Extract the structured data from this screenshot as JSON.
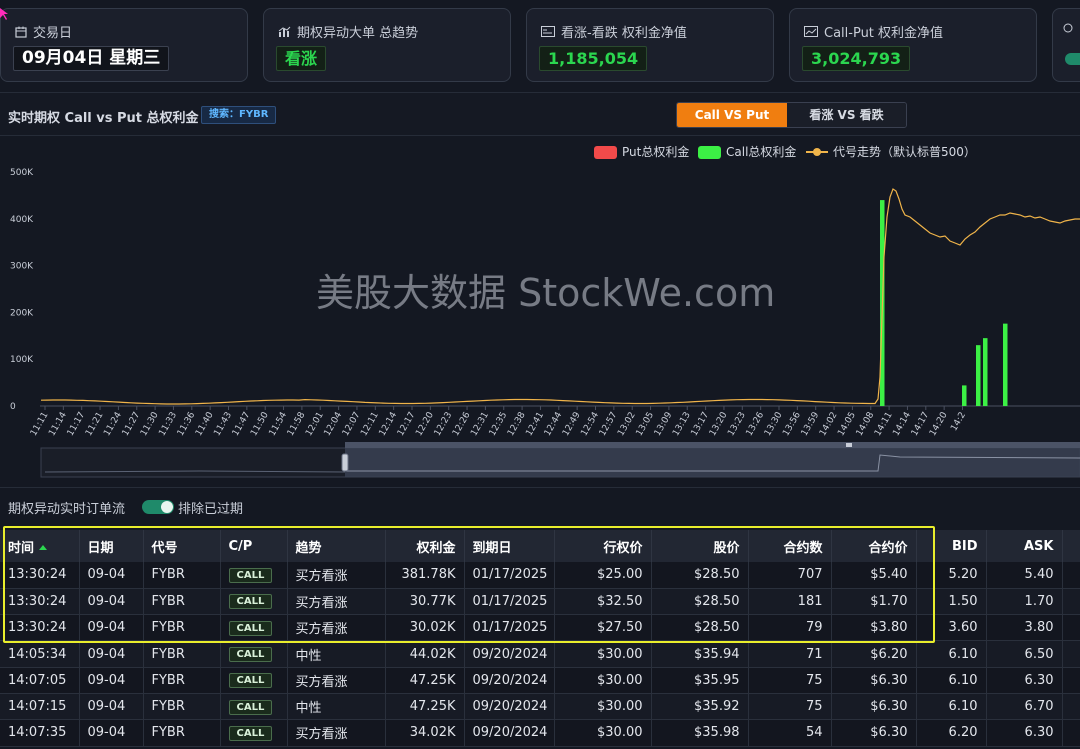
{
  "cards": [
    {
      "title": "交易日",
      "icon": "calendar-icon",
      "value": "09月04日 星期三",
      "color": "#ffffff"
    },
    {
      "title": "期权异动大单 总趋势",
      "icon": "bar-chart-icon",
      "value": "看涨",
      "color": "#2bd64f"
    },
    {
      "title": "看涨-看跌 权利金净值",
      "icon": "card-icon",
      "value": "1,185,054",
      "color": "#2bd64f"
    },
    {
      "title": "Call-Put 权利金净值",
      "icon": "trend-card-icon",
      "value": "3,024,793",
      "color": "#2bd64f"
    }
  ],
  "chart_header": {
    "title": "实时期权 Call vs Put 总权利金",
    "search_badge": "搜索：FYBR",
    "toggle_active": "Call VS Put",
    "toggle_idle": "看涨 VS 看跌"
  },
  "watermark": "美股大数据 StockWe.com",
  "chart_data": {
    "type": "bar",
    "legend": [
      "Put总权利金",
      "Call总权利金",
      "代号走势（默认标普500）"
    ],
    "legend_colors": {
      "put": "#f24a4a",
      "call": "#3cf045",
      "index": "#f0b44a"
    },
    "y_ticks": [
      "0",
      "100K",
      "200K",
      "300K",
      "400K",
      "500K"
    ],
    "ylim": [
      0,
      500000
    ],
    "x_labels": [
      "11:11",
      "11:14",
      "11:17",
      "11:21",
      "11:24",
      "11:27",
      "11:30",
      "11:33",
      "11:36",
      "11:40",
      "11:43",
      "11:47",
      "11:50",
      "11:54",
      "11:58",
      "12:01",
      "12:04",
      "12:07",
      "12:11",
      "12:14",
      "12:17",
      "12:20",
      "12:23",
      "12:26",
      "12:31",
      "12:35",
      "12:38",
      "12:41",
      "12:44",
      "12:49",
      "12:54",
      "12:57",
      "13:02",
      "13:05",
      "13:09",
      "13:13",
      "13:17",
      "13:20",
      "13:23",
      "13:26",
      "13:30",
      "13:56",
      "13:59",
      "14:02",
      "14:05",
      "14:08",
      "14:11",
      "14:14",
      "14:17",
      "14:20",
      "14:2"
    ],
    "call_bars": [
      {
        "x": "13:30",
        "value": 440000
      },
      {
        "x": "14:05",
        "value": 44000
      },
      {
        "x": "14:07",
        "value": 130000
      },
      {
        "x": "14:07b",
        "value": 145000
      },
      {
        "x": "14:11",
        "value": 176000
      }
    ],
    "put_bars": [],
    "index_line_note": "index line values shown in the chart's own units"
  },
  "flow": {
    "title": "期权异动实时订单流",
    "toggle_label": "排除已过期"
  },
  "table": {
    "columns": [
      "时间",
      "日期",
      "代号",
      "C/P",
      "趋势",
      "权利金",
      "到期日",
      "行权价",
      "股价",
      "合约数",
      "合约价",
      "BID",
      "ASK"
    ],
    "rows": [
      [
        "13:30:24",
        "09-04",
        "FYBR",
        "CALL",
        "买方看涨",
        "381.78K",
        "01/17/2025",
        "$25.00",
        "$28.50",
        "707",
        "$5.40",
        "5.20",
        "5.40"
      ],
      [
        "13:30:24",
        "09-04",
        "FYBR",
        "CALL",
        "买方看涨",
        "30.77K",
        "01/17/2025",
        "$32.50",
        "$28.50",
        "181",
        "$1.70",
        "1.50",
        "1.70"
      ],
      [
        "13:30:24",
        "09-04",
        "FYBR",
        "CALL",
        "买方看涨",
        "30.02K",
        "01/17/2025",
        "$27.50",
        "$28.50",
        "79",
        "$3.80",
        "3.60",
        "3.80"
      ],
      [
        "14:05:34",
        "09-04",
        "FYBR",
        "CALL",
        "中性",
        "44.02K",
        "09/20/2024",
        "$30.00",
        "$35.94",
        "71",
        "$6.20",
        "6.10",
        "6.50"
      ],
      [
        "14:07:05",
        "09-04",
        "FYBR",
        "CALL",
        "买方看涨",
        "47.25K",
        "09/20/2024",
        "$30.00",
        "$35.95",
        "75",
        "$6.30",
        "6.10",
        "6.30"
      ],
      [
        "14:07:15",
        "09-04",
        "FYBR",
        "CALL",
        "中性",
        "47.25K",
        "09/20/2024",
        "$30.00",
        "$35.92",
        "75",
        "$6.30",
        "6.10",
        "6.70"
      ],
      [
        "14:07:35",
        "09-04",
        "FYBR",
        "CALL",
        "买方看涨",
        "34.02K",
        "09/20/2024",
        "$30.00",
        "$35.98",
        "54",
        "$6.30",
        "6.20",
        "6.30"
      ]
    ]
  }
}
